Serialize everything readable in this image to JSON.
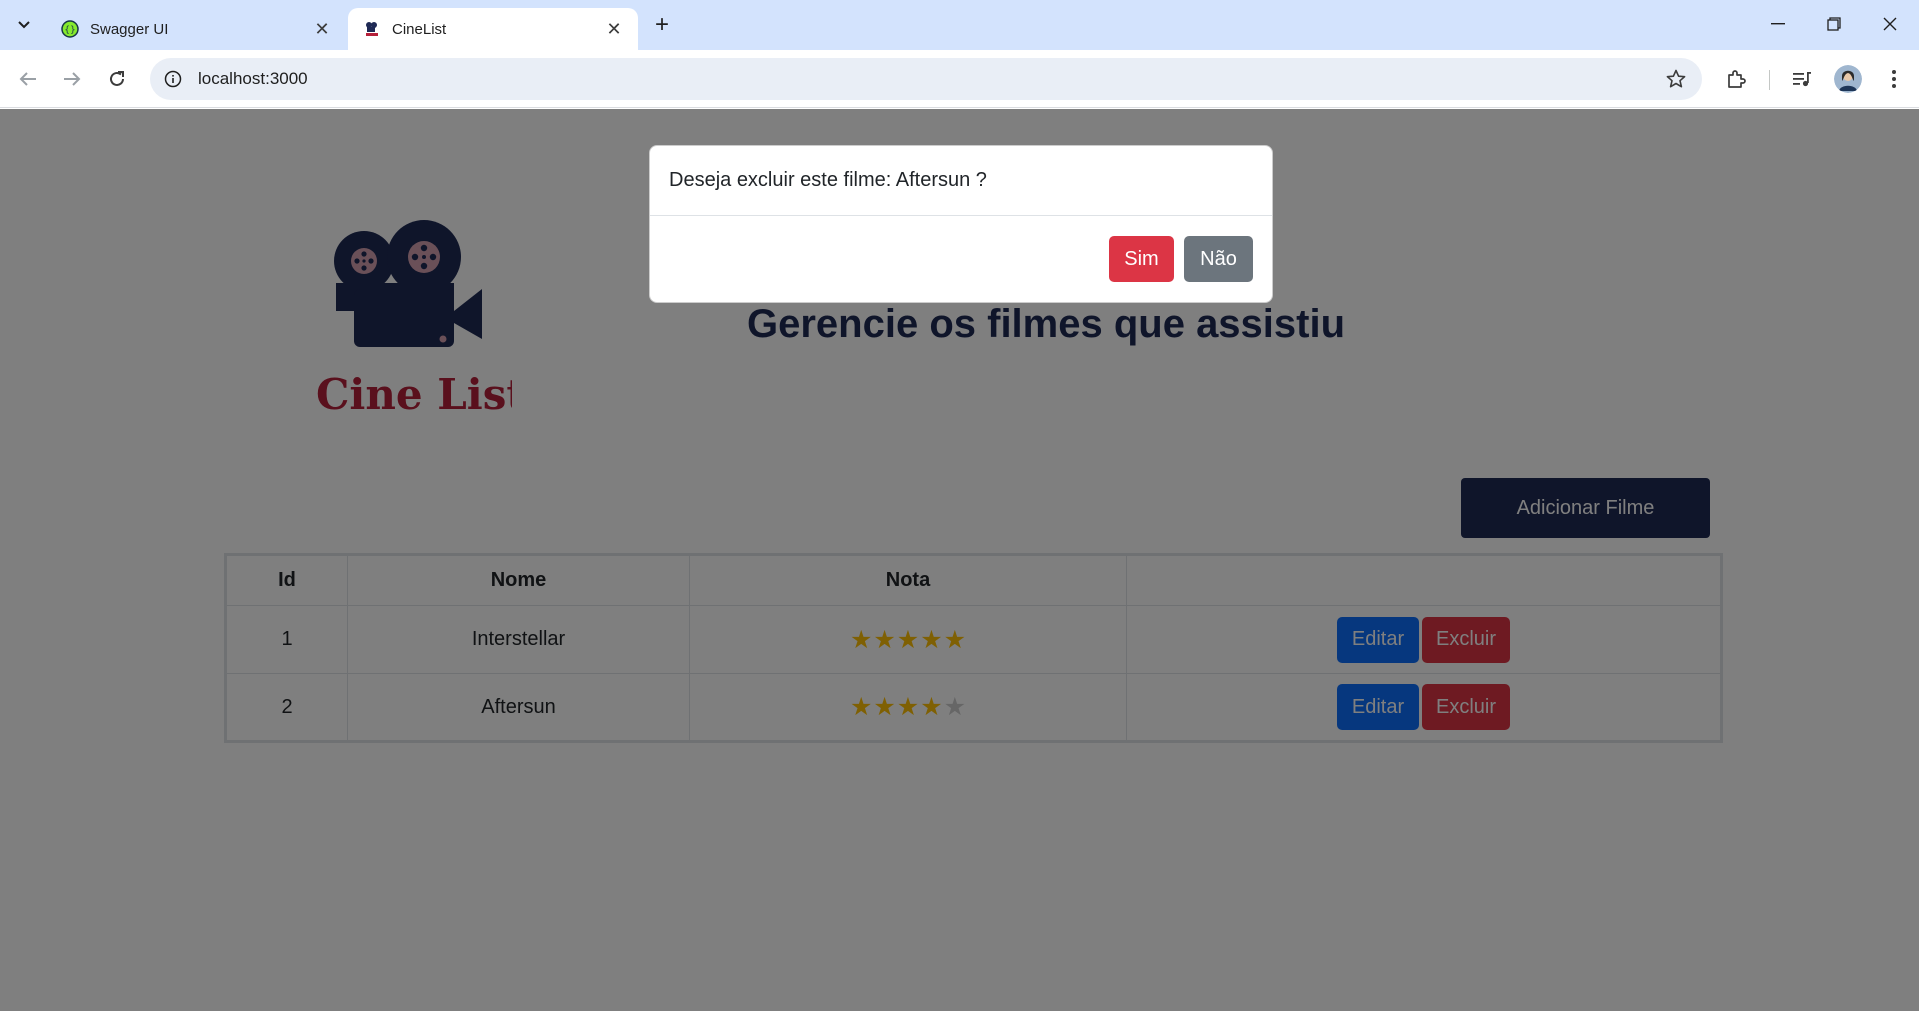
{
  "browser": {
    "tabs": [
      {
        "title": "Swagger UI",
        "active": false,
        "favicon": "swagger-icon"
      },
      {
        "title": "CineList",
        "active": true,
        "favicon": "cinelist-icon"
      }
    ],
    "address": "localhost:3000"
  },
  "page": {
    "logo_text": "Cine List",
    "headline": "Gerencie os filmes que assistiu",
    "add_button": "Adicionar Filme",
    "table": {
      "headers": {
        "id": "Id",
        "nome": "Nome",
        "nota": "Nota",
        "actions": ""
      },
      "rows": [
        {
          "id": "1",
          "nome": "Interstellar",
          "nota": 5,
          "max": 5,
          "edit": "Editar",
          "delete": "Excluir"
        },
        {
          "id": "2",
          "nome": "Aftersun",
          "nota": 4,
          "max": 5,
          "edit": "Editar",
          "delete": "Excluir"
        }
      ]
    }
  },
  "modal": {
    "message": "Deseja excluir este filme: Aftersun ?",
    "yes_label": "Sim",
    "no_label": "Não"
  },
  "colors": {
    "brand_navy": "#1f2a55",
    "brand_red": "#b5203a",
    "danger": "#dc3545",
    "primary": "#0d6efd",
    "secondary": "#6c757d",
    "star": "#ffc107"
  }
}
